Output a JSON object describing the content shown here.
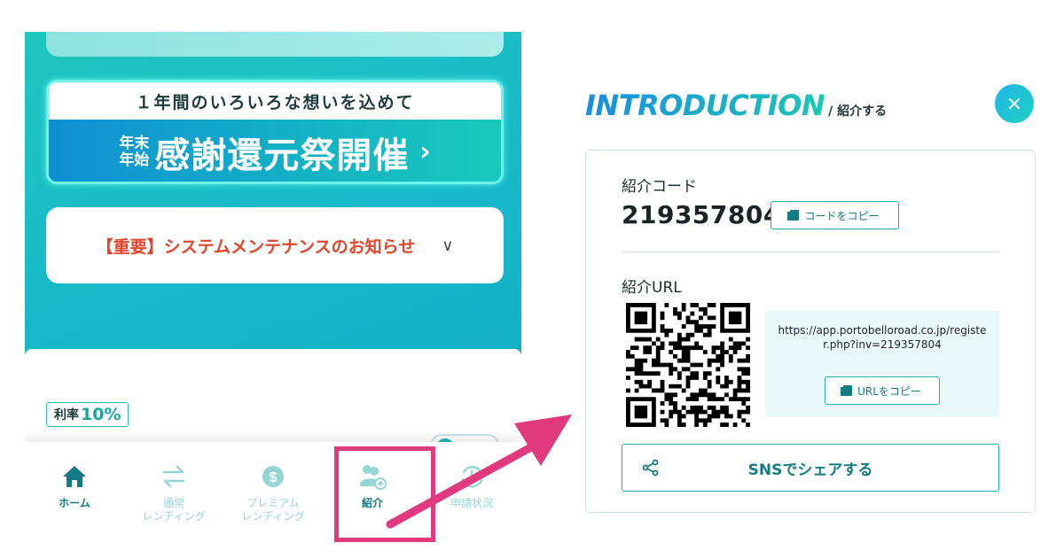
{
  "phone": {
    "banner_top": "１年間のいろいろな想いを込めて",
    "banner_small_1": "年末",
    "banner_small_2": "年始",
    "banner_big": "感謝還元祭開催",
    "banner_chevron": "›",
    "notice_text": "【重要】システムメンテナンスのお知らせ",
    "notice_chevron": "∨",
    "rate_label": "利率",
    "rate_value": "10%",
    "nav": [
      {
        "label": "ホーム",
        "icon": "home-icon"
      },
      {
        "label": "通常\nレンディング",
        "icon": "swap-arrows-icon"
      },
      {
        "label": "プレミアム\nレンディング",
        "icon": "dollar-coin-icon"
      },
      {
        "label": "紹介",
        "icon": "add-user-icon"
      },
      {
        "label": "申請状況",
        "icon": "clock-history-icon"
      }
    ],
    "active_nav": "紹介"
  },
  "modal": {
    "title_en": "INTRODUCTION",
    "title_jp": "/ 紹介する",
    "close_glyph": "×",
    "code_label": "紹介コード",
    "code_value": "219357804",
    "code_copy_label": "コードをコピー",
    "url_label": "紹介URL",
    "url_value": "https://app.portobelloroad.co.jp/register.php?inv=219357804",
    "url_copy_label": "URLをコピー",
    "sns_label": "SNSでシェアする"
  },
  "colors": {
    "teal": "#1fb3ad",
    "dark_teal": "#157b83",
    "highlight": "#e0397e",
    "notice_red": "#e0452c"
  }
}
